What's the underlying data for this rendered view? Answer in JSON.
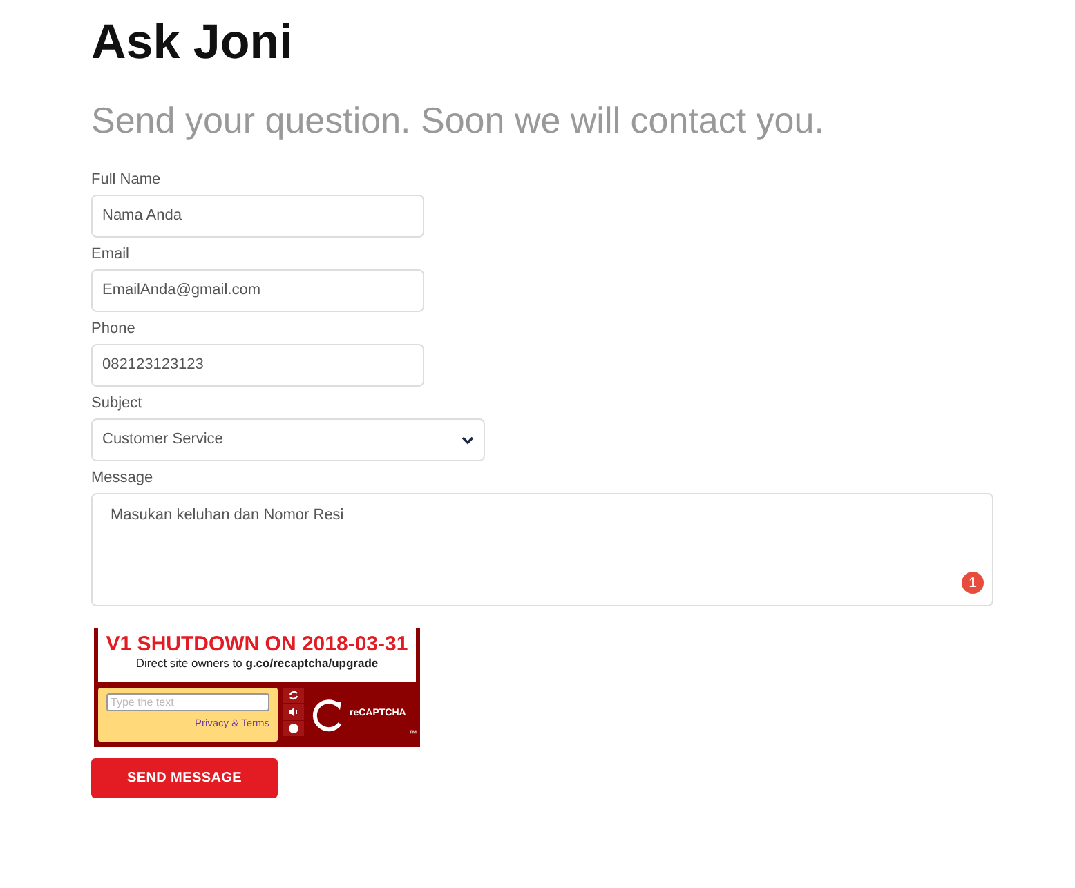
{
  "title": "Ask Joni",
  "subtitle": "Send your question. Soon we will contact you.",
  "fields": [
    {
      "kind": "input",
      "label": "Full Name",
      "value": "Nama Anda"
    },
    {
      "kind": "input",
      "label": "Email",
      "value": "EmailAnda@gmail.com"
    },
    {
      "kind": "input",
      "label": "Phone",
      "value": "082123123123"
    },
    {
      "kind": "select",
      "label": "Subject",
      "value": "Customer Service"
    },
    {
      "kind": "textarea",
      "label": "Message",
      "value": "Masukan keluhan dan Nomor Resi",
      "badge": "1"
    }
  ],
  "captcha": {
    "headline": "V1 SHUTDOWN ON 2018-03-31",
    "notice": "Direct site owners to **g.co/recaptcha/upgrade**",
    "placeholder": "Type the text",
    "privacy_link": "Privacy & Terms",
    "logo_text": "reCAPTCHA",
    "trademark": "™"
  },
  "submit_button": "SEND MESSAGE"
}
